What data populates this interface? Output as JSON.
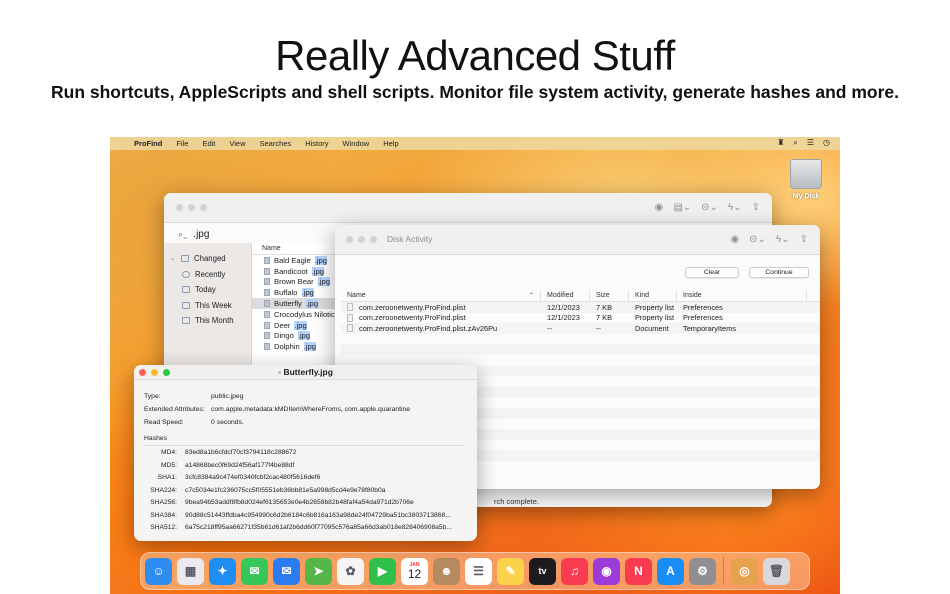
{
  "hero": {
    "title": "Really Advanced Stuff",
    "subtitle": "Run shortcuts, AppleScripts and shell scripts. Monitor file system activity, generate hashes and more."
  },
  "menubar": {
    "app": "ProFind",
    "items": [
      "File",
      "Edit",
      "View",
      "Searches",
      "History",
      "Window",
      "Help"
    ]
  },
  "desktop": {
    "drive_label": "My Disk"
  },
  "profind": {
    "search_query": ".jpg",
    "sidebar": {
      "group": "Changed",
      "items": [
        "Recently",
        "Today",
        "This Week",
        "This Month"
      ]
    },
    "file_header": "Name",
    "files": [
      {
        "base": "Bald Eagle",
        "ext": ".jpg"
      },
      {
        "base": "Bandicoot",
        "ext": ".jpg"
      },
      {
        "base": "Brown Bear",
        "ext": ".jpg"
      },
      {
        "base": "Buffalo",
        "ext": ".jpg"
      },
      {
        "base": "Butterfly",
        "ext": ".jpg"
      },
      {
        "base": "Crocodylus Nilotic",
        "ext": ""
      },
      {
        "base": "Deer",
        "ext": ".jpg"
      },
      {
        "base": "Dingo",
        "ext": ".jpg"
      },
      {
        "base": "Dolphin",
        "ext": ".jpg"
      }
    ],
    "status": "rch complete."
  },
  "disk_activity": {
    "title": "Disk Activity",
    "clear_label": "Clear",
    "continue_label": "Continue",
    "headers": {
      "name": "Name",
      "modified": "Modified",
      "size": "Size",
      "kind": "Kind",
      "inside": "Inside"
    },
    "rows": [
      {
        "name": "com.zeroonetwenty.ProFind.plist",
        "modified": "12/1/2023",
        "size": "7 KB",
        "kind": "Property list",
        "inside": "Preferences"
      },
      {
        "name": "com.zeroonetwenty.ProFind.plist",
        "modified": "12/1/2023",
        "size": "7 KB",
        "kind": "Property list",
        "inside": "Preferences"
      },
      {
        "name": "com.zeroonetwenty.ProFind.plist.zAv26Pu",
        "modified": "--",
        "size": "--",
        "kind": "Document",
        "inside": "TemporaryItems"
      }
    ]
  },
  "info": {
    "title": "Butterfly.jpg",
    "type_label": "Type:",
    "type_value": "public.jpeg",
    "ext_label": "Extended Attributes:",
    "ext_value": "com.apple.metadata:kMDItemWhereFroms, com.apple.quarantine",
    "speed_label": "Read Speed:",
    "speed_value": "0 seconds.",
    "hashes_label": "Hashes",
    "hashes": [
      {
        "k": "MD4:",
        "v": "83ed8a1b6cfdcf70cf3794118c288672"
      },
      {
        "k": "MD5:",
        "v": "a14868bec0f69d24f56af177f4be88df"
      },
      {
        "k": "SHA1:",
        "v": "3cfc8384a9c474ef0340fcbf2cac480f5616def6"
      },
      {
        "k": "SHA224:",
        "v": "c7c5034e1fc236075cc5f05551eb36bb81e5a998d5cd4e9e78f80b0a"
      },
      {
        "k": "SHA256:",
        "v": "9bea94b53addf8fb8d024ef6135653e0e4b2658b82b48faf4a54da971d2b706e"
      },
      {
        "k": "SHA384:",
        "v": "90d88c51443ffdba4c954990c6d2b6184c6b816a163a98de24f04729ba51bc3803713868..."
      },
      {
        "k": "SHA512:",
        "v": "6a75c218ff95aa66271f35b61d61af2b6dd60f77095c576a85a66d3ab018e828406908a5b..."
      }
    ]
  },
  "dock": {
    "calendar_month": "JAN",
    "calendar_day": "12",
    "tv_label": "tv",
    "icons": [
      {
        "name": "finder-icon",
        "color": "#2f8cf0",
        "glyph": "☺"
      },
      {
        "name": "launchpad-icon",
        "color": "#e9e9ef",
        "glyph": "▦"
      },
      {
        "name": "safari-icon",
        "color": "#1e8ef2",
        "glyph": "✦"
      },
      {
        "name": "messages-icon",
        "color": "#35c759",
        "glyph": "✉"
      },
      {
        "name": "mail-icon",
        "color": "#2b7cf3",
        "glyph": "✉"
      },
      {
        "name": "maps-icon",
        "color": "#56b64a",
        "glyph": "➤"
      },
      {
        "name": "photos-icon",
        "color": "#f4f4f4",
        "glyph": "✿"
      },
      {
        "name": "facetime-icon",
        "color": "#30c04a",
        "glyph": "▶"
      },
      {
        "name": "calendar-icon",
        "color": "#ffffff",
        "glyph": ""
      },
      {
        "name": "contacts-icon",
        "color": "#b48a5e",
        "glyph": "☻"
      },
      {
        "name": "reminders-icon",
        "color": "#ffffff",
        "glyph": "☰"
      },
      {
        "name": "notes-icon",
        "color": "#fbd34a",
        "glyph": "✎"
      },
      {
        "name": "appletv-icon",
        "color": "#1c1c1e",
        "glyph": ""
      },
      {
        "name": "music-icon",
        "color": "#fa3c53",
        "glyph": "♫"
      },
      {
        "name": "podcasts-icon",
        "color": "#9b3bd9",
        "glyph": "◉"
      },
      {
        "name": "news-icon",
        "color": "#f83b4f",
        "glyph": "N"
      },
      {
        "name": "appstore-icon",
        "color": "#1a8cf5",
        "glyph": "A"
      },
      {
        "name": "settings-icon",
        "color": "#8e8e93",
        "glyph": "⚙"
      },
      {
        "name": "profind-icon",
        "color": "#e6a24c",
        "glyph": "◎"
      },
      {
        "name": "trash-icon",
        "color": "#d9d9dc",
        "glyph": "🗑"
      }
    ]
  }
}
